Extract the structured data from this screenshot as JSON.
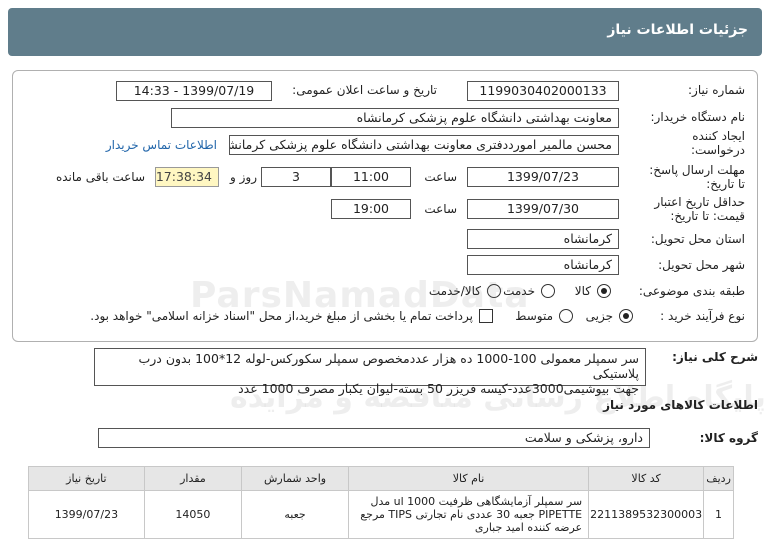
{
  "header": {
    "title": "جزئیات اطلاعات نیاز"
  },
  "form": {
    "need_number_label": "شماره نیاز:",
    "need_number": "1199030402000133",
    "announce_label": "تاریخ و ساعت اعلان عمومی:",
    "announce_value": "1399/07/19 - 14:33",
    "buyer_label": "نام دستگاه خریدار:",
    "buyer_value": "معاونت بهداشتی دانشگاه علوم پزشکی کرمانشاه",
    "creator_label_1": "ایجاد کننده",
    "creator_label_2": "درخواست:",
    "creator_value": "محسن مالمیر امورددفتری معاونت بهداشتی دانشگاه علوم پزشکی کرمانشاه",
    "contact_link": "اطلاعات تماس خریدار",
    "deadline_label_1": "مهلت ارسال پاسخ:",
    "deadline_label_2": "تا تاریخ:",
    "deadline_date": "1399/07/23",
    "time_label": "ساعت",
    "deadline_time": "11:00",
    "days_value": "3",
    "days_label": "روز و",
    "remaining_time": "17:38:34",
    "remaining_label": "ساعت باقی مانده",
    "validity_label_1": "حداقل تاریخ اعتبار",
    "validity_label_2": "قیمت: تا تاریخ:",
    "validity_date": "1399/07/30",
    "validity_time_label": "ساعت",
    "validity_time": "19:00",
    "province_label": "استان محل تحویل:",
    "province_value": "کرمانشاه",
    "city_label": "شهر محل تحویل:",
    "city_value": "کرمانشاه",
    "category_label": "طبقه بندی موضوعی:",
    "category_options": [
      "کالا",
      "خدمت",
      "کالا/خدمت"
    ],
    "category_selected": "کالا",
    "process_label": "نوع فرآیند خرید :",
    "process_options": [
      "جزیی",
      "متوسط"
    ],
    "process_selected": "جزیی",
    "payment_note": "پرداخت تمام یا بخشی از مبلغ خرید،از محل \"اسناد خزانه اسلامی\" خواهد بود."
  },
  "description": {
    "label": "شرح کلی نیاز:",
    "line1": "سر سمپلر معمولی 100-1000 ده هزار عددمخصوص  سمپلر سکورکس-لوله 12*100 بدون درب پلاستیکی",
    "line2": "جهت بیوشیمی3000عدد-کیسه فریزر 50 بسته-لیوان یکبار مصرف  1000 عدد"
  },
  "goods_section": {
    "title": "اطلاعات کالاهای مورد نیاز",
    "group_label": "گروه کالا:",
    "group_value": "دارو، پزشکی و سلامت"
  },
  "table": {
    "headers": [
      "ردیف",
      "کد کالا",
      "نام کالا",
      "واحد شمارش",
      "مقدار",
      "تاریخ نیاز"
    ],
    "rows": [
      {
        "row": "1",
        "code": "2211389532300003",
        "name": "سر سمپلر آزمایشگاهی ظرفیت 1000 ul مدل PIPETTE جعبه 30 عددی نام تجارتی TIPS مرجع عرضه کننده امید جباری",
        "unit": "جعبه",
        "qty": "14050",
        "date": "1399/07/23"
      }
    ]
  },
  "watermark": {
    "line1": "ParsNamadData",
    "line2": "پایگاه اطلاع رسانی مناقصه و مزایده"
  }
}
